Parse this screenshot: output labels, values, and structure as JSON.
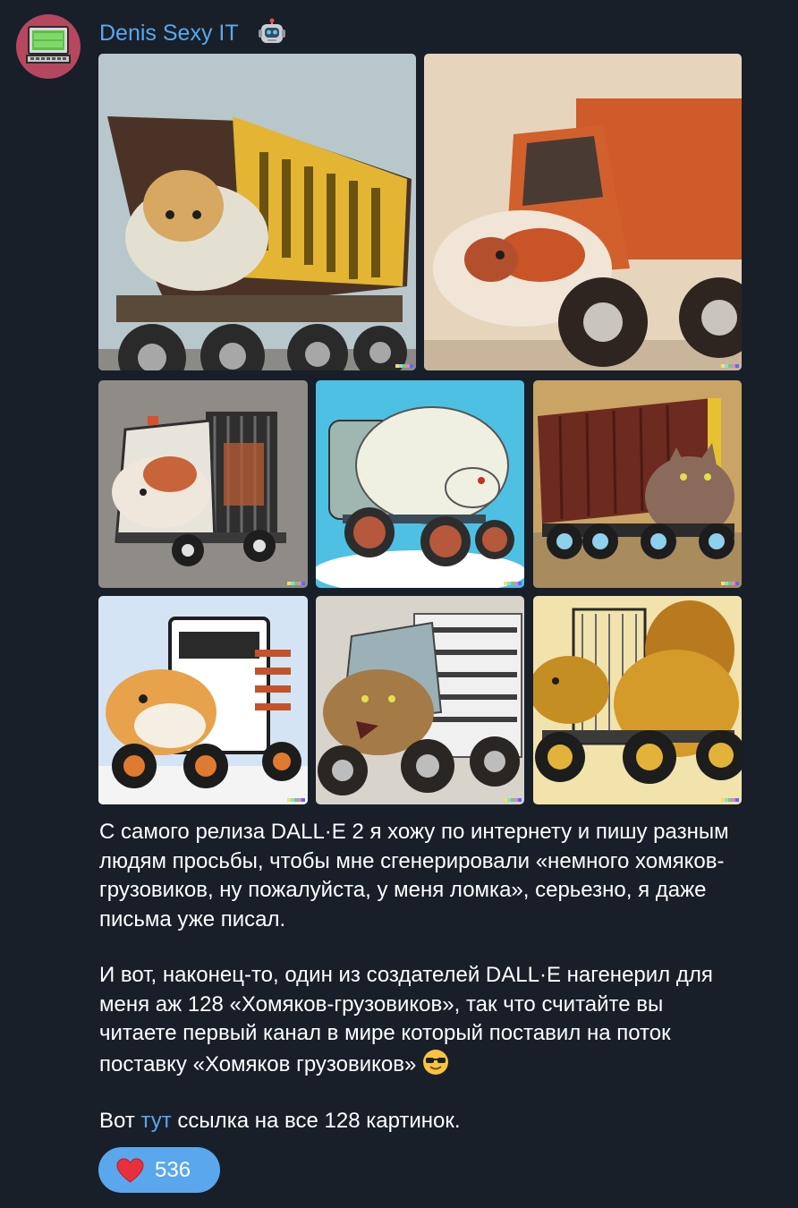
{
  "channel": {
    "name": "Denis Sexy IT",
    "avatar_text": "Denis Sexy IT",
    "badge_icon": "robot-emoji-icon"
  },
  "post": {
    "images": [
      {
        "label": "hamster-dump-truck-yellow",
        "bg": "#b8c7cc",
        "accent": "#e3b533"
      },
      {
        "label": "hamster-truck-orange",
        "bg": "#e6d4bd",
        "accent": "#cf5a2a"
      },
      {
        "label": "hamster-cage-truck",
        "bg": "#8f8b87",
        "accent": "#ffffff"
      },
      {
        "label": "white-rat-truck",
        "bg": "#4ec0e3",
        "accent": "#efefe2"
      },
      {
        "label": "cat-container-truck",
        "bg": "#c9a465",
        "accent": "#6d2a20"
      },
      {
        "label": "hamster-camper-truck",
        "bg": "#d4e4f5",
        "accent": "#2a2a2a"
      },
      {
        "label": "cat-steel-truck",
        "bg": "#d8d4cc",
        "accent": "#6f6e6a"
      },
      {
        "label": "squirrel-gold-truck",
        "bg": "#f2e3ad",
        "accent": "#c58e23"
      }
    ],
    "paragraph1": "С самого релиза DALL·E 2 я хожу по интернету и пишу разным людям просьбы, чтобы мне сгенерировали «немного хомяков-грузовиков, ну пожалуйста, у меня ломка», серьезно, я даже письма уже писал.",
    "paragraph2": "И вот, наконец-то, один из создателей DALL·E нагенерил для меня аж 128 «Хомяков-грузовиков», так что считайте вы читаете первый канал в мире который поставил на поток поставку «Хомяков грузовиков»",
    "paragraph2_emoji": "sunglasses-emoji-icon",
    "paragraph3_prefix": "Вот ",
    "paragraph3_link": "тут",
    "paragraph3_suffix": " ссылка на все 128 картинок."
  },
  "reaction": {
    "icon": "heart-icon",
    "count": "536"
  },
  "colors": {
    "background": "#181f29",
    "accent": "#5aa7ee",
    "text": "#ffffff",
    "avatar": "#b6475f"
  }
}
